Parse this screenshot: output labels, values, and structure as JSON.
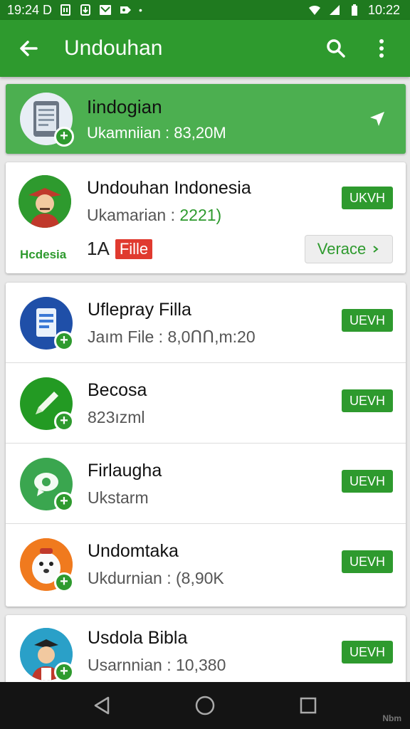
{
  "status_bar": {
    "time_left": "19:24 D",
    "time_right": "10:22"
  },
  "app_bar": {
    "title": "Undouhan",
    "icons": [
      "back-arrow-icon",
      "search-icon",
      "more-vert-icon"
    ]
  },
  "highlight": {
    "name": "Iindogian",
    "subtitle": "Ukamniian : 83,20M",
    "icon": "tablet-download-icon"
  },
  "featured": {
    "name": "Undouhan Indonesia",
    "subtitle_prefix": "Ukamarian : ",
    "subtitle_value": "2221)",
    "button": "UKVH",
    "caption": "Hcdesia",
    "file_count": "1A",
    "file_tag": "Fille",
    "version_button": "Verace",
    "icon": "indonesian-man-avatar"
  },
  "list": [
    {
      "name": "Uflepray Filla",
      "subtitle": "Jaım File : 8,0ՈՈ,m:20",
      "button": "UEVH",
      "icon": "document-app-icon"
    },
    {
      "name": "Becosa",
      "subtitle": "823ızml",
      "button": "UEVH",
      "icon": "pencil-app-icon"
    },
    {
      "name": "Firlaugha",
      "subtitle": "Ukstarm",
      "button": "UEVH",
      "icon": "chat-bubble-app-icon"
    },
    {
      "name": "Undomtaka",
      "subtitle": "Ukdurnian : (8,90K",
      "button": "UEVH",
      "icon": "mascot-app-icon"
    }
  ],
  "last": {
    "name": "Usdola Bibla",
    "subtitle": "Usarnnian : 10,380",
    "button": "UEVH",
    "icon": "man-avatar-blue"
  },
  "watermark": "Nbm",
  "colors": {
    "primary": "#2e9a2e",
    "primary_dark": "#1f7a1f",
    "highlight_bg": "#4caf50",
    "tag_red": "#e03a2f"
  }
}
